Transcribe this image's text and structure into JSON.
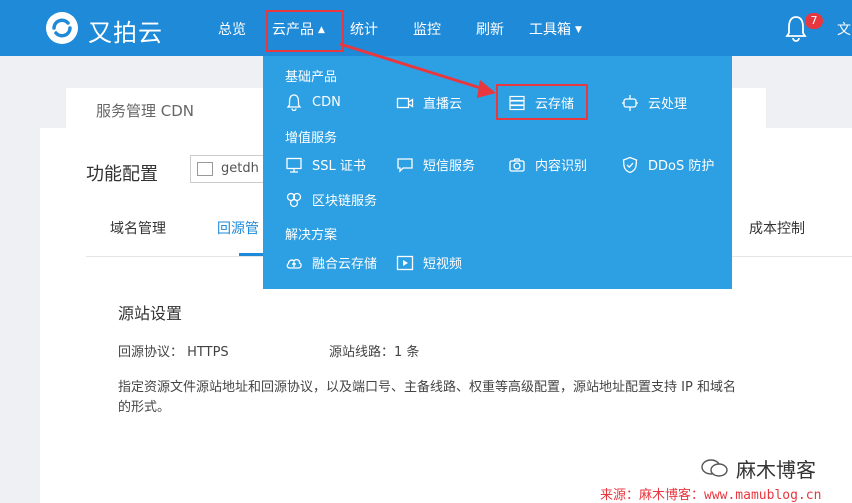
{
  "topbar": {
    "brand": "又拍云",
    "nav": [
      {
        "label": "总览"
      },
      {
        "label": "云产品"
      },
      {
        "label": "统计"
      },
      {
        "label": "监控"
      },
      {
        "label": "刷新"
      },
      {
        "label": "工具箱"
      }
    ],
    "notification_count": "7",
    "user_initial": "文"
  },
  "breadcrumb": "服务管理 CDN",
  "page": {
    "section_title": "功能配置",
    "domain_select_value": "getdh",
    "tabs": [
      "域名管理",
      "回源管",
      "成本控制"
    ],
    "active_tab": "回源管",
    "origin_title": "源站设置",
    "protocol_label": "回源协议：",
    "protocol_value": "HTTPS",
    "route_label": "源站线路：",
    "route_value": "1 条",
    "description": "指定资源文件源站地址和回源协议，以及端口号、主备线路、权重等高级配置，源站地址配置支持 IP 和域名的形式。"
  },
  "dropdown": {
    "groups": [
      {
        "title": "基础产品",
        "items": [
          {
            "label": "CDN",
            "icon": "bell-icon"
          },
          {
            "label": "直播云",
            "icon": "video-camera-icon"
          },
          {
            "label": "云存储",
            "icon": "storage-icon"
          },
          {
            "label": "云处理",
            "icon": "processing-icon"
          }
        ]
      },
      {
        "title": "增值服务",
        "items": [
          {
            "label": "SSL 证书",
            "icon": "certificate-icon"
          },
          {
            "label": "短信服务",
            "icon": "message-icon"
          },
          {
            "label": "内容识别",
            "icon": "camera-icon"
          },
          {
            "label": "DDoS 防护",
            "icon": "shield-icon"
          },
          {
            "label": "区块链服务",
            "icon": "blockchain-icon"
          }
        ]
      },
      {
        "title": "解决方案",
        "items": [
          {
            "label": "融合云存储",
            "icon": "cloud-upload-icon"
          },
          {
            "label": "短视频",
            "icon": "play-icon"
          }
        ]
      }
    ]
  },
  "watermark": {
    "brand": "麻木博客",
    "source": "来源：麻木博客：www.mamublog.cn"
  },
  "colors": {
    "topbar": "#1f8ad8",
    "dropdown": "#2d9fe3",
    "highlight": "#e8373f"
  }
}
